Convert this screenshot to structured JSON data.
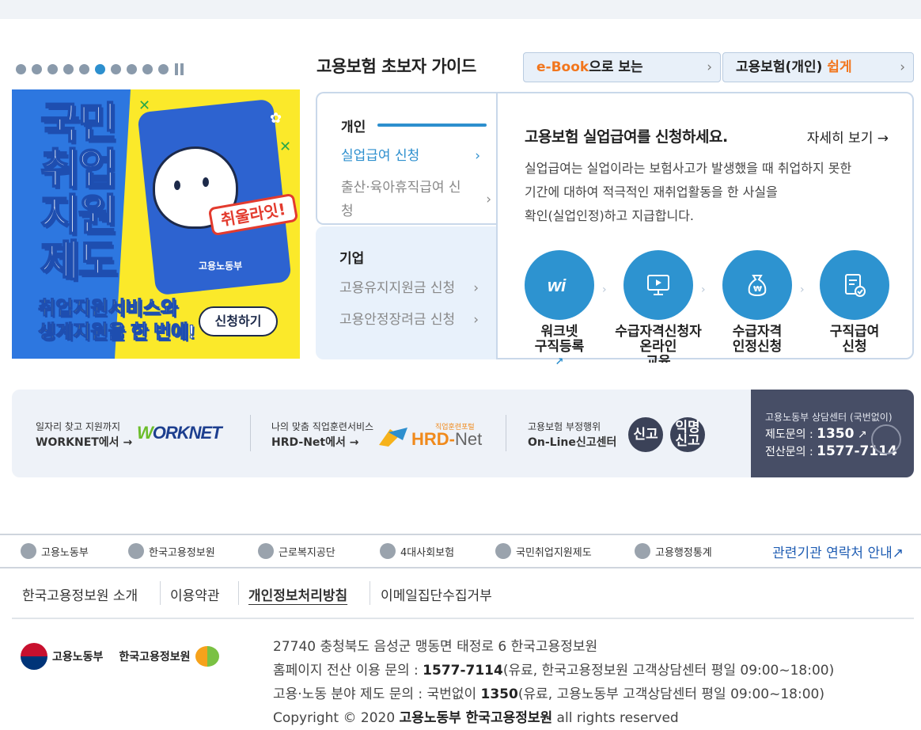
{
  "carousel": {
    "dot_count": 10,
    "active_dot": 5,
    "banner": {
      "title_lines": [
        "국민",
        "취업",
        "지원",
        "제도"
      ],
      "sub_1a": "취업지원서비스",
      "sub_1b": "와",
      "sub_2a": "생계지원",
      "sub_2b": "을 한 번에!",
      "tag": "취울라잇!",
      "logo": "고용노동부",
      "button": "신청하기"
    }
  },
  "guide": {
    "title": "고용보험 초보자 가이드",
    "pill_ebook_accent": "e-Book",
    "pill_ebook_rest": "으로 보는",
    "pill_easy_rest": "고용보험(개인) ",
    "pill_easy_accent": "쉽게",
    "personal": {
      "head": "개인",
      "items": [
        "실업급여 신청",
        "출산·육아휴직급여 신청"
      ]
    },
    "company": {
      "head": "기업",
      "items": [
        "고용유지지원금 신청",
        "고용안정장려금 신청"
      ]
    },
    "panel": {
      "title": "고용보험 실업급여를 신청하세요.",
      "more": "자세히 보기",
      "desc_lines": [
        "실업급여는 실업이라는 보험사고가 발생했을 때 취업하지 못한",
        "기간에 대하여 적극적인 재취업활동을 한 사실을",
        "확인(실업인정)하고 지급합니다."
      ],
      "steps": [
        {
          "label1": "워크넷",
          "label2": "구직등록",
          "icon": "worknet-icon"
        },
        {
          "label1": "수급자격신청자",
          "label2": "온라인",
          "label3": "교육",
          "icon": "monitor-icon"
        },
        {
          "label1": "수급자격",
          "label2": "인정신청",
          "icon": "money-bag-icon"
        },
        {
          "label1": "구직급여",
          "label2": "신청",
          "icon": "document-check-icon"
        }
      ]
    }
  },
  "strip": {
    "worknet_small": "일자리 찾고 지원까지",
    "worknet_bold": "WORKNET에서",
    "worknet_logo_g": "W",
    "worknet_logo": "ORKNET",
    "hrd_small": "나의 맞춤 직업훈련서비스",
    "hrd_bold": "HRD-Net에서",
    "hrd_logo_a": "HRD-",
    "hrd_logo_b": "Net",
    "hrd_mini": "직업훈련포털",
    "report_small": "고용보험 부정행위",
    "report_bold": "On-Line신고센터",
    "report_btn": "신고",
    "anon_btn": "익명\n신고",
    "call_head": "고용노동부 상담센터 (국번없이)",
    "call_1_label": "제도문의 : ",
    "call_1_num": "1350",
    "call_2_label": "전산문의 : ",
    "call_2_num": "1577-7114"
  },
  "orgs": {
    "items": [
      "고용노동부",
      "한국고용정보원",
      "근로복지공단",
      "4대사회보험",
      "국민취업지원제도",
      "고용행정통계"
    ],
    "contact": "관련기관 연락처 안내"
  },
  "footer": {
    "links": [
      "한국고용정보원 소개",
      "이용약관",
      "개인정보처리방침",
      "이메일집단수집거부"
    ],
    "logo_moel": "고용노동부",
    "logo_keis": "한국고용정보원",
    "addr1": "27740 충청북도 음성군 맹동면 태정로 6 한국고용정보원",
    "addr2_a": "홈페이지 전산 이용 문의 : ",
    "addr2_b": "1577-7114",
    "addr2_c": "(유료, 한국고용정보원 고객상담센터 평일 09:00~18:00)",
    "addr3_a": "고용·노동 분야 제도 문의 : 국번없이 ",
    "addr3_b": "1350",
    "addr3_c": "(유료, 고용노동부 고객상담센터 평일 09:00~18:00)",
    "copy_a": "Copyright © 2020 ",
    "copy_b": "고용노동부 한국고용정보원",
    "copy_c": " all rights reserved"
  }
}
